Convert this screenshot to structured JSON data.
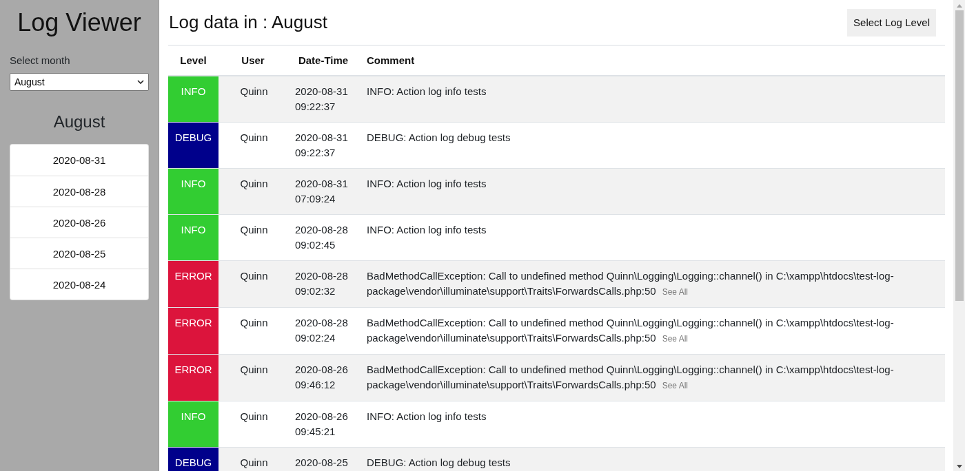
{
  "sidebar": {
    "title": "Log Viewer",
    "month_label": "Select month",
    "month_select": {
      "value": "August"
    },
    "month_heading": "August",
    "dates": [
      "2020-08-31",
      "2020-08-28",
      "2020-08-26",
      "2020-08-25",
      "2020-08-24"
    ]
  },
  "main": {
    "title": "Log data in : August",
    "level_button": "Select Log Level"
  },
  "table": {
    "columns": [
      "Level",
      "User",
      "Date-Time",
      "Comment"
    ],
    "rows": [
      {
        "severity": "INFO",
        "color": "#32cd32",
        "user": "Quinn",
        "date_time": "2020-08-31 09:22:37",
        "comment": "INFO: Action log info tests"
      },
      {
        "severity": "DEBUG",
        "color": "#00008b",
        "user": "Quinn",
        "date_time": "2020-08-31 09:22:37",
        "comment": "DEBUG: Action log debug tests"
      },
      {
        "severity": "INFO",
        "color": "#32cd32",
        "user": "Quinn",
        "date_time": "2020-08-31 07:09:24",
        "comment": "INFO: Action log info tests"
      },
      {
        "severity": "INFO",
        "color": "#32cd32",
        "user": "Quinn",
        "date_time": "2020-08-28 09:02:45",
        "comment": "INFO: Action log info tests"
      },
      {
        "severity": "ERROR",
        "color": "#dc143c",
        "user": "Quinn",
        "date_time": "2020-08-28 09:02:32",
        "comment": "BadMethodCallException: Call to undefined method Quinn\\Logging\\Logging::channel() in C:\\xampp\\htdocs\\test-log-package\\vendor\\illuminate\\support\\Traits\\ForwardsCalls.php:50",
        "link": "See All"
      },
      {
        "severity": "ERROR",
        "color": "#dc143c",
        "user": "Quinn",
        "date_time": "2020-08-28 09:02:24",
        "comment": "BadMethodCallException: Call to undefined method Quinn\\Logging\\Logging::channel() in C:\\xampp\\htdocs\\test-log-package\\vendor\\illuminate\\support\\Traits\\ForwardsCalls.php:50",
        "link": "See All"
      },
      {
        "severity": "ERROR",
        "color": "#dc143c",
        "user": "Quinn",
        "date_time": "2020-08-26 09:46:12",
        "comment": "BadMethodCallException: Call to undefined method Quinn\\Logging\\Logging::channel() in C:\\xampp\\htdocs\\test-log-package\\vendor\\illuminate\\support\\Traits\\ForwardsCalls.php:50",
        "link": "See All"
      },
      {
        "severity": "INFO",
        "color": "#32cd32",
        "user": "Quinn",
        "date_time": "2020-08-26 09:45:21",
        "comment": "INFO: Action log info tests"
      },
      {
        "severity": "DEBUG",
        "color": "#00008b",
        "user": "Quinn",
        "date_time": "2020-08-25",
        "comment": "DEBUG: Action log debug tests"
      }
    ]
  }
}
